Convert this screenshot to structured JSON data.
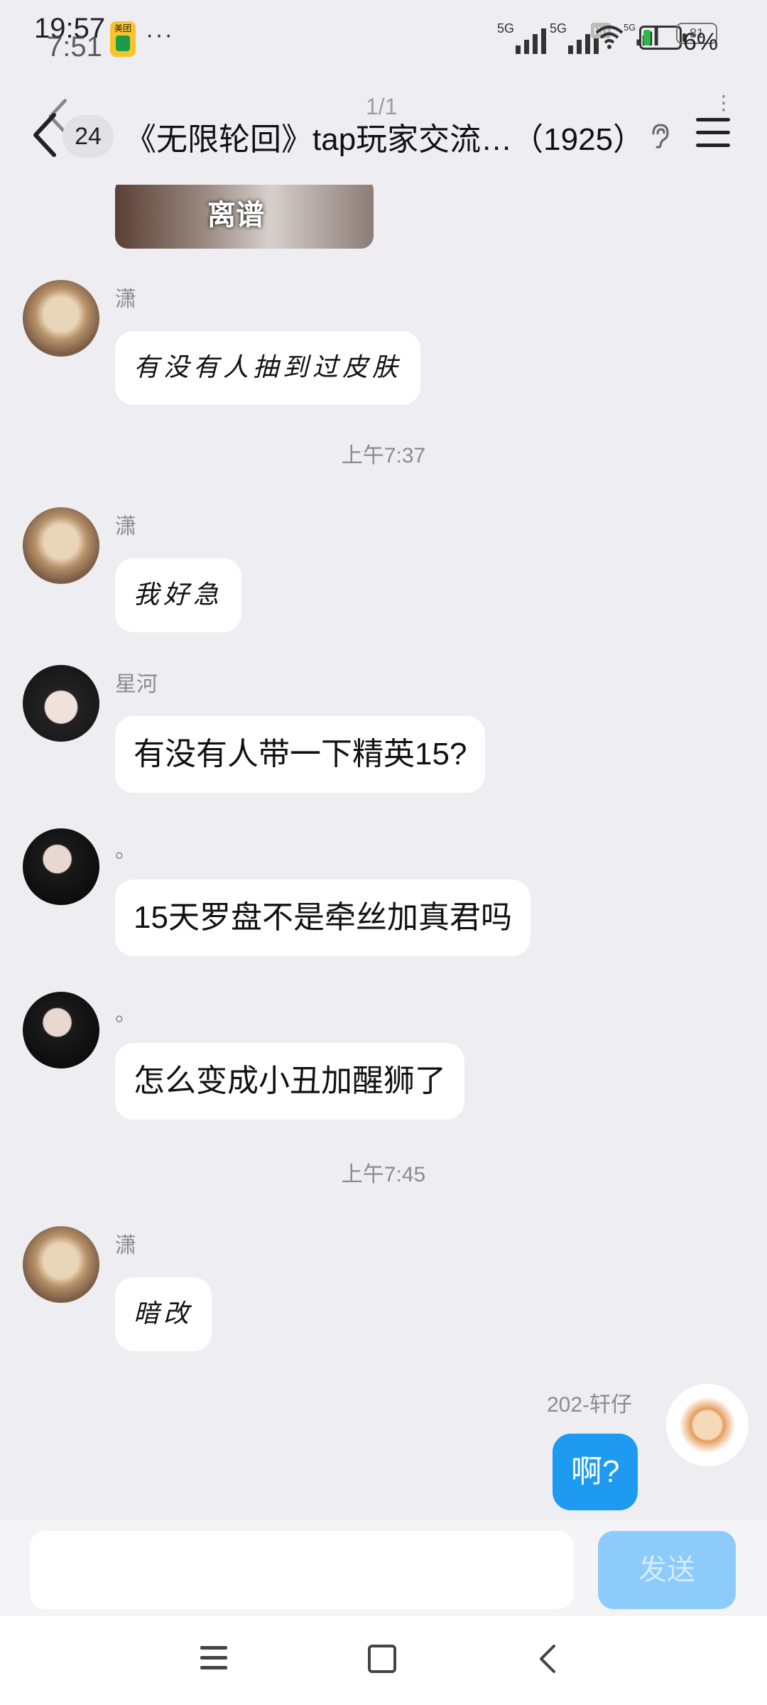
{
  "status_bar": {
    "time": "19:57",
    "time_overlay": "7:51",
    "meituan_label": "美团",
    "more": "···",
    "network1": "5G",
    "network2": "5G",
    "network3": "5G",
    "hd": "HD",
    "battery_level": "81",
    "battery_overlay": "6%"
  },
  "header": {
    "unread_count": "24",
    "group_title": "《无限轮回》tap玩家交流…（1925）",
    "page_indicator": "1/1"
  },
  "messages": {
    "image_caption": "离谱",
    "m1": {
      "sender": "潇",
      "text": "有没有人抽到过皮肤"
    },
    "ts1": "上午7:37",
    "m2": {
      "sender": "潇",
      "text": "我好急"
    },
    "m3": {
      "sender": "星河",
      "text": "有没有人带一下精英15?"
    },
    "m4": {
      "sender": "。",
      "text": "15天罗盘不是牵丝加真君吗"
    },
    "m5": {
      "sender": "。",
      "text": "怎么变成小丑加醒狮了"
    },
    "ts2": "上午7:45",
    "m6": {
      "sender": "潇",
      "text": "暗改"
    },
    "m7": {
      "sender": "202-轩仔",
      "text": "啊?"
    }
  },
  "input": {
    "placeholder": "",
    "send_label": "发送"
  },
  "colors": {
    "background": "#EEEEF2",
    "my_bubble": "#1E9BF0",
    "send_disabled": "#8DCBFA"
  }
}
